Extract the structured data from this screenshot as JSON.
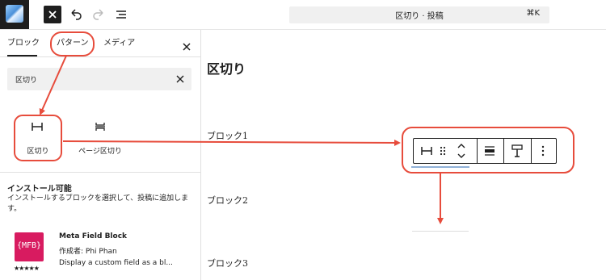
{
  "topbar": {
    "command_title": "区切り · 投稿",
    "command_shortcut": "⌘K",
    "icons": [
      "wordpress-site-icon",
      "close-icon",
      "undo-icon",
      "redo-icon",
      "document-overview-icon"
    ]
  },
  "inserter": {
    "tabs": [
      "ブロック",
      "パターン",
      "メディア"
    ],
    "search_value": "区切り",
    "blocks": [
      {
        "label": "区切り",
        "icon": "separator-icon"
      },
      {
        "label": "ページ区切り",
        "icon": "page-break-icon"
      }
    ],
    "install": {
      "title": "インストール可能",
      "description": "インストールするブロックを選択して、投稿に追加します。"
    },
    "plugin": {
      "logo_text": "{MFB}",
      "name": "Meta Field Block",
      "author": "作成者: Phi Phan",
      "description": "Display a custom field as a bl...",
      "rating_stars": 5,
      "stars_text": "★★★★★"
    }
  },
  "editor": {
    "title": "区切り",
    "paragraphs": [
      "ブロック1",
      "ブロック2",
      "ブロック3"
    ]
  },
  "block_toolbar": {
    "icons": [
      "separator-icon",
      "drag-handle-icon",
      "move-up-icon",
      "move-down-icon",
      "align-icon",
      "style-icon",
      "more-options-icon"
    ]
  },
  "colors": {
    "annotation_red": "#e74c3c",
    "dark": "#1e1e1e",
    "mfb_brand": "#d81b60"
  }
}
